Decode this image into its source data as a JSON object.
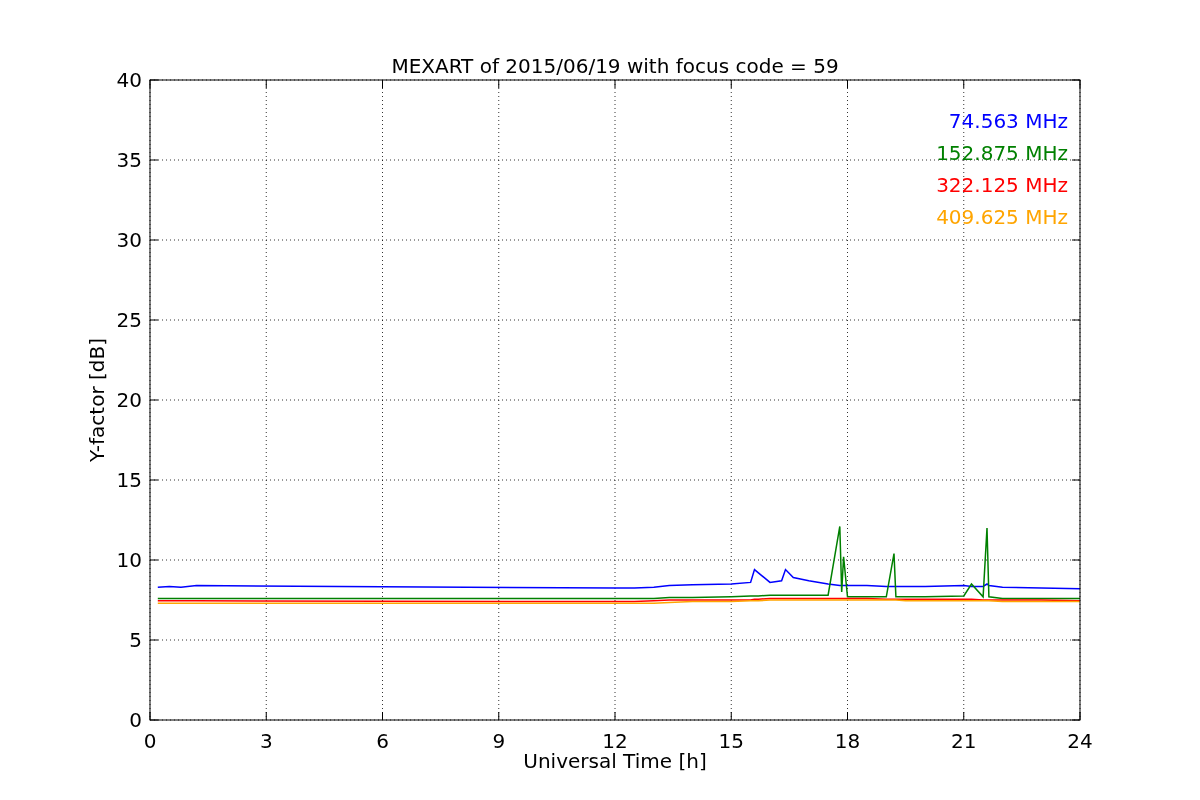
{
  "chart": {
    "chart_data": {
      "type": "line",
      "title": "MEXART of 2015/06/19 with focus code = 59",
      "xlabel": "Universal Time [h]",
      "ylabel": "Y-factor [dB]",
      "x": [
        0.2,
        0.5,
        0.8,
        1.2,
        12,
        12.5,
        13,
        13.4,
        14,
        15,
        15.5,
        15.6,
        15.7,
        16,
        16.3,
        16.4,
        16.6,
        17,
        17.5,
        17.8,
        17.85,
        17.9,
        18,
        18.5,
        19,
        19.2,
        19.25,
        19.5,
        20,
        21,
        21.2,
        21.5,
        21.6,
        21.65,
        22,
        23,
        24
      ],
      "series": [
        {
          "name": "74.563 MHz",
          "color": "#0000ff",
          "values": [
            8.3,
            8.35,
            8.3,
            8.4,
            8.25,
            8.25,
            8.3,
            8.4,
            8.45,
            8.5,
            8.6,
            9.4,
            9.2,
            8.6,
            8.7,
            9.4,
            8.9,
            8.7,
            8.5,
            8.4,
            8.4,
            8.4,
            8.4,
            8.4,
            8.35,
            8.35,
            8.35,
            8.35,
            8.35,
            8.4,
            8.35,
            8.35,
            8.5,
            8.4,
            8.3,
            8.25,
            8.2
          ]
        },
        {
          "name": "152.875 MHz",
          "color": "#008000",
          "values": [
            7.6,
            7.6,
            7.6,
            7.6,
            7.6,
            7.6,
            7.6,
            7.65,
            7.65,
            7.7,
            7.75,
            7.75,
            7.75,
            7.8,
            7.8,
            7.8,
            7.8,
            7.8,
            7.8,
            12.1,
            8.0,
            10.2,
            7.7,
            7.7,
            7.7,
            10.4,
            7.7,
            7.7,
            7.7,
            7.75,
            8.5,
            7.7,
            12.0,
            7.7,
            7.6,
            7.6,
            7.6
          ]
        },
        {
          "name": "322.125 MHz",
          "color": "#ff0000",
          "values": [
            7.45,
            7.45,
            7.45,
            7.45,
            7.4,
            7.4,
            7.45,
            7.5,
            7.5,
            7.5,
            7.5,
            7.55,
            7.55,
            7.6,
            7.6,
            7.6,
            7.6,
            7.6,
            7.6,
            7.6,
            7.6,
            7.6,
            7.6,
            7.6,
            7.55,
            7.55,
            7.55,
            7.55,
            7.55,
            7.55,
            7.55,
            7.5,
            7.5,
            7.5,
            7.5,
            7.5,
            7.45
          ]
        },
        {
          "name": "409.625 MHz",
          "color": "#ffa500",
          "values": [
            7.3,
            7.3,
            7.3,
            7.3,
            7.3,
            7.3,
            7.3,
            7.35,
            7.4,
            7.4,
            7.45,
            7.45,
            7.45,
            7.5,
            7.5,
            7.5,
            7.5,
            7.5,
            7.5,
            7.5,
            7.5,
            7.5,
            7.5,
            7.5,
            7.5,
            7.5,
            7.5,
            7.45,
            7.45,
            7.45,
            7.45,
            7.45,
            7.45,
            7.45,
            7.4,
            7.4,
            7.4
          ]
        }
      ],
      "xlim": [
        0,
        24
      ],
      "ylim": [
        0,
        40
      ],
      "xticks": [
        0,
        3,
        6,
        9,
        12,
        15,
        18,
        21,
        24
      ],
      "yticks": [
        0,
        5,
        10,
        15,
        20,
        25,
        30,
        35,
        40
      ],
      "grid": true
    }
  }
}
